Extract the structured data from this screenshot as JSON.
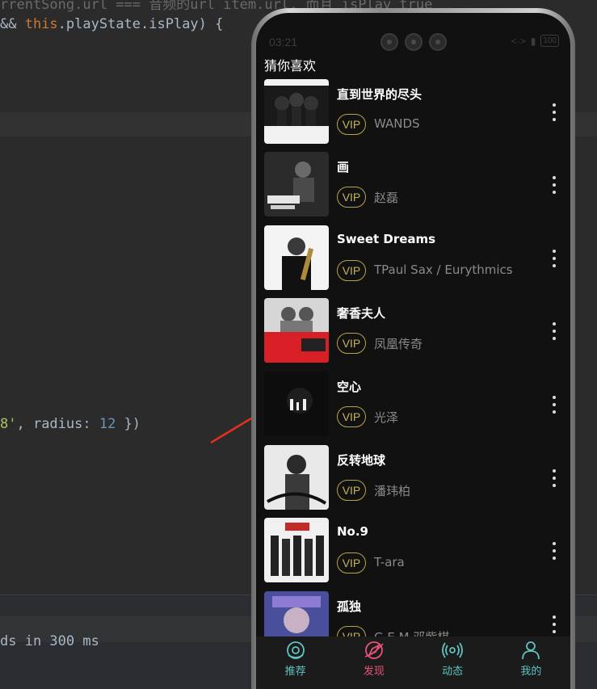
{
  "editor": {
    "line_top": "rrentSong.url === 音频的url item.url, 而且 isPlay true",
    "line_1_kw": "this",
    "line_1_rest": ".playState.isPlay) {",
    "line_1_prefix": "&& ",
    "line_2_str": "8'",
    "line_2_mid": ", radius: ",
    "line_2_num": "12",
    "line_2_end": " })",
    "bottom_text": "ds in 300 ms"
  },
  "status_bar": {
    "time": "03:21",
    "signal": "<·>",
    "battery": "100"
  },
  "section": {
    "title": "猜你喜欢"
  },
  "vip_label": "VIP",
  "songs": [
    {
      "title": "直到世界的尽头",
      "artist": "WANDS"
    },
    {
      "title": "画",
      "artist": "赵磊"
    },
    {
      "title": "Sweet Dreams",
      "artist": "TPaul Sax / Eurythmics"
    },
    {
      "title": "奢香夫人",
      "artist": "凤凰传奇"
    },
    {
      "title": "空心",
      "artist": "光泽"
    },
    {
      "title": "反转地球",
      "artist": "潘玮柏"
    },
    {
      "title": "No.9",
      "artist": "T-ara"
    },
    {
      "title": "孤独",
      "artist": "G.E.M.邓紫棋"
    }
  ],
  "tabbar": {
    "tabs": [
      {
        "label": "推荐",
        "icon": "disc-icon",
        "color": "#5fc3c0"
      },
      {
        "label": "发现",
        "icon": "compass-icon",
        "color": "#e8537a"
      },
      {
        "label": "动态",
        "icon": "broadcast-icon",
        "color": "#5fc3c0"
      },
      {
        "label": "我的",
        "icon": "user-icon",
        "color": "#5fc3c0"
      }
    ]
  },
  "colors": {
    "accent": "#e8537a",
    "tab_inactive": "#5fc3c0",
    "vip": "#c5b25a"
  }
}
